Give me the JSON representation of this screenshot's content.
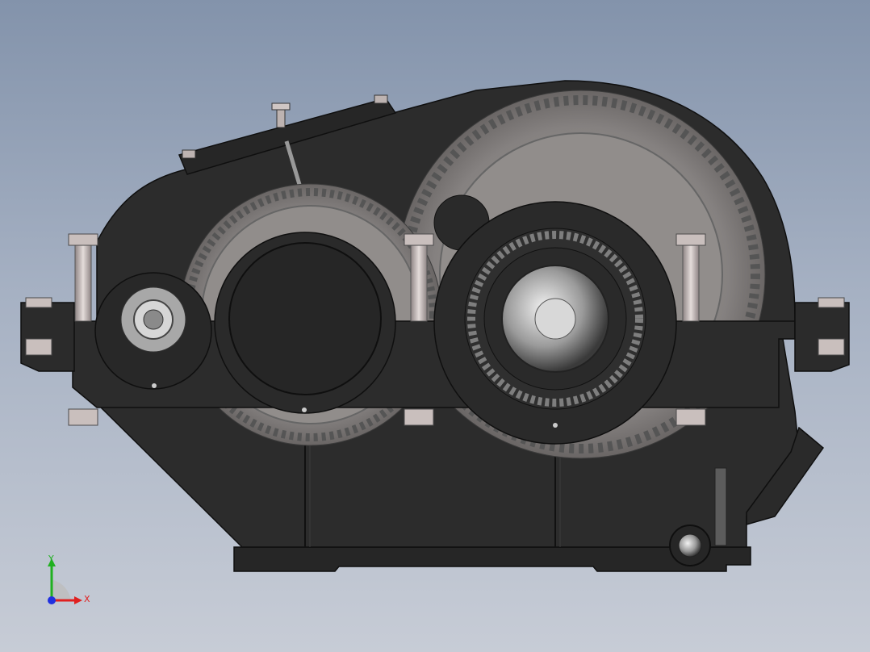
{
  "viewport": {
    "background_top": "#8393ab",
    "background_bottom": "#c7ccd6"
  },
  "model": {
    "kind": "two-stage gear reducer",
    "view": "front",
    "colors": {
      "housing": "#2b2b2b",
      "housing_edge": "#121212",
      "gear": "#8e8a88",
      "gear_dark": "#6e6a69",
      "bolt": "#c9bfbd",
      "shaft": "#bdbdbd"
    }
  },
  "triad": {
    "x_label": "X",
    "y_label": "Y",
    "x_color": "#e02020",
    "y_color": "#20b020",
    "z_color": "#2030e0"
  }
}
